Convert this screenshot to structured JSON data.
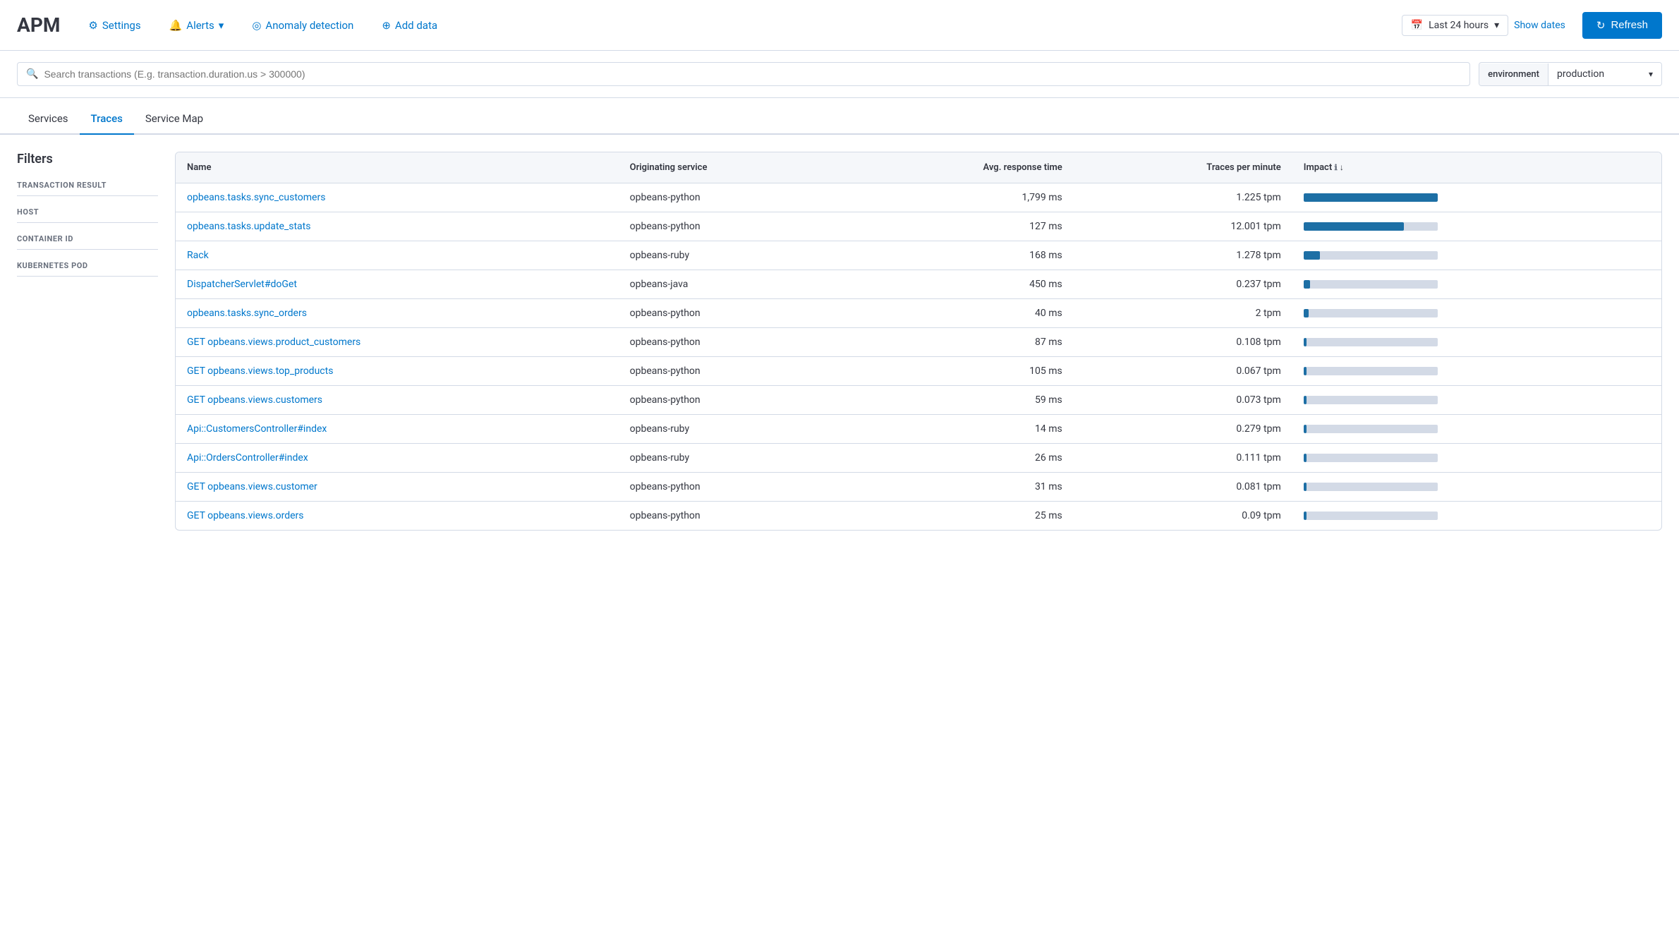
{
  "header": {
    "app_title": "APM",
    "nav_items": [
      {
        "id": "settings",
        "label": "Settings",
        "icon": "⚙"
      },
      {
        "id": "alerts",
        "label": "Alerts",
        "icon": "🔔",
        "has_arrow": true
      },
      {
        "id": "anomaly-detection",
        "label": "Anomaly detection",
        "icon": "◎"
      },
      {
        "id": "add-data",
        "label": "Add data",
        "icon": "⊕"
      }
    ],
    "time_range": "Last 24 hours",
    "show_dates_label": "Show dates",
    "refresh_label": "Refresh"
  },
  "search": {
    "placeholder": "Search transactions (E.g. transaction.duration.us > 300000)",
    "environment_label": "environment",
    "environment_value": "production"
  },
  "tabs": [
    {
      "id": "services",
      "label": "Services",
      "active": false
    },
    {
      "id": "traces",
      "label": "Traces",
      "active": true
    },
    {
      "id": "service-map",
      "label": "Service Map",
      "active": false
    }
  ],
  "filters": {
    "title": "Filters",
    "groups": [
      {
        "id": "transaction-result",
        "label": "TRANSACTION RESULT"
      },
      {
        "id": "host",
        "label": "HOST"
      },
      {
        "id": "container-id",
        "label": "CONTAINER ID"
      },
      {
        "id": "kubernetes-pod",
        "label": "KUBERNETES POD"
      }
    ]
  },
  "table": {
    "columns": [
      {
        "id": "name",
        "label": "Name"
      },
      {
        "id": "originating-service",
        "label": "Originating service"
      },
      {
        "id": "avg-response-time",
        "label": "Avg. response time"
      },
      {
        "id": "traces-per-minute",
        "label": "Traces per minute"
      },
      {
        "id": "impact",
        "label": "Impact"
      }
    ],
    "rows": [
      {
        "name": "opbeans.tasks.sync_customers",
        "originating_service": "opbeans-python",
        "avg_response_time": "1,799 ms",
        "traces_per_minute": "1.225 tpm",
        "impact_pct": 100
      },
      {
        "name": "opbeans.tasks.update_stats",
        "originating_service": "opbeans-python",
        "avg_response_time": "127 ms",
        "traces_per_minute": "12.001 tpm",
        "impact_pct": 75
      },
      {
        "name": "Rack",
        "originating_service": "opbeans-ruby",
        "avg_response_time": "168 ms",
        "traces_per_minute": "1.278 tpm",
        "impact_pct": 12
      },
      {
        "name": "DispatcherServlet#doGet",
        "originating_service": "opbeans-java",
        "avg_response_time": "450 ms",
        "traces_per_minute": "0.237 tpm",
        "impact_pct": 5
      },
      {
        "name": "opbeans.tasks.sync_orders",
        "originating_service": "opbeans-python",
        "avg_response_time": "40 ms",
        "traces_per_minute": "2 tpm",
        "impact_pct": 4
      },
      {
        "name": "GET opbeans.views.product_customers",
        "originating_service": "opbeans-python",
        "avg_response_time": "87 ms",
        "traces_per_minute": "0.108 tpm",
        "impact_pct": 2
      },
      {
        "name": "GET opbeans.views.top_products",
        "originating_service": "opbeans-python",
        "avg_response_time": "105 ms",
        "traces_per_minute": "0.067 tpm",
        "impact_pct": 2
      },
      {
        "name": "GET opbeans.views.customers",
        "originating_service": "opbeans-python",
        "avg_response_time": "59 ms",
        "traces_per_minute": "0.073 tpm",
        "impact_pct": 2
      },
      {
        "name": "Api::CustomersController#index",
        "originating_service": "opbeans-ruby",
        "avg_response_time": "14 ms",
        "traces_per_minute": "0.279 tpm",
        "impact_pct": 2
      },
      {
        "name": "Api::OrdersController#index",
        "originating_service": "opbeans-ruby",
        "avg_response_time": "26 ms",
        "traces_per_minute": "0.111 tpm",
        "impact_pct": 2
      },
      {
        "name": "GET opbeans.views.customer",
        "originating_service": "opbeans-python",
        "avg_response_time": "31 ms",
        "traces_per_minute": "0.081 tpm",
        "impact_pct": 2
      },
      {
        "name": "GET opbeans.views.orders",
        "originating_service": "opbeans-python",
        "avg_response_time": "25 ms",
        "traces_per_minute": "0.09 tpm",
        "impact_pct": 2
      }
    ]
  }
}
